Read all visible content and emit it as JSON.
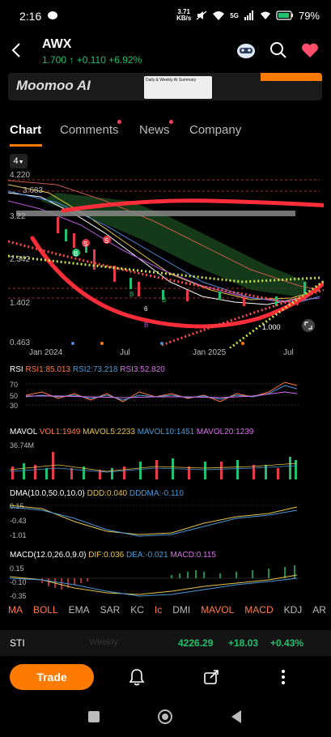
{
  "status": {
    "time": "2:16",
    "net_speed": "3.71",
    "net_unit": "KB/s",
    "signal": "5G",
    "battery": "79%"
  },
  "header": {
    "ticker": "AWX",
    "price": "1.700",
    "change": "+0.110",
    "change_pct": "+6.92%",
    "up_color": "#21c06e"
  },
  "banner": {
    "title": "Moomoo AI",
    "card_title": "Daily & Weekly AI Summary"
  },
  "tabs": [
    "Chart",
    "Comments",
    "News",
    "Company"
  ],
  "period": {
    "value": "4",
    "icon": "chevron-down-icon"
  },
  "price_axis": [
    "4.220",
    "3.683",
    "3.22",
    "2.342",
    "1.402",
    "0.463"
  ],
  "date_axis": [
    "Jan 2024",
    "Jul",
    "Jan 2025",
    "Jul"
  ],
  "chart_markers": [
    "B",
    "S",
    "S",
    "B",
    "B",
    "B",
    "6",
    "1.000"
  ],
  "rsi": {
    "label": "RSI",
    "v1": "RSI1:85.013",
    "v2": "RSI2:73.218",
    "v3": "RSI3:52.820",
    "ticks": [
      "70",
      "50",
      "30"
    ]
  },
  "mavol": {
    "label": "MAVOL",
    "v1": "VOL1:1949",
    "v2": "MAVOL5:2233",
    "v3": "MAVOL10:1451",
    "v4": "MAVOL20:1239",
    "max": "36.74M"
  },
  "dma": {
    "label": "DMA(10.0,50.0,10.0)",
    "v1": "DDD:0.040",
    "v2": "DDDMA:-0.110",
    "ticks": [
      "0.15",
      "-0.43",
      "-1.01"
    ]
  },
  "macd": {
    "label": "MACD(12.0,26.0,9.0)",
    "v1": "DIF:0.036",
    "v2": "DEA:-0.021",
    "v3": "MACD:0.115",
    "ticks": [
      "0.15",
      "-0.10",
      "-0.35"
    ]
  },
  "indicator_tabs": [
    "MA",
    "BOLL",
    "EMA",
    "SAR",
    "KC",
    "Ic",
    "DMI",
    "MAVOL",
    "MACD",
    "KDJ",
    "AR"
  ],
  "sti": {
    "name": "STI",
    "value": "4226.29",
    "change": "+18.03",
    "pct": "+0.43%",
    "faded_text": "Weekly"
  },
  "trade_label": "Trade",
  "colors": {
    "accent": "#ff7a00",
    "up": "#21c06e",
    "down": "#ff3b5c",
    "annotation": "#ff2d3a"
  }
}
